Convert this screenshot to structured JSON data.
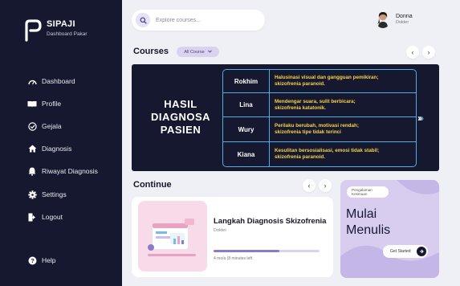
{
  "app": {
    "name": "SIPAJI",
    "subtitle": "Dashboard Pakar"
  },
  "sidebar": {
    "items": [
      {
        "label": "Dashboard",
        "icon": "gauge-icon"
      },
      {
        "label": "Profile",
        "icon": "book-open-icon"
      },
      {
        "label": "Gejala",
        "icon": "check-circle-icon"
      },
      {
        "label": "Diagnosis",
        "icon": "home-icon"
      },
      {
        "label": "Riwayat Diagnosis",
        "icon": "bell-icon"
      },
      {
        "label": "Settings",
        "icon": "gear-icon"
      },
      {
        "label": "Logout",
        "icon": "logout-icon"
      }
    ],
    "help_label": "Help"
  },
  "search": {
    "placeholder": "Explore courses..."
  },
  "user": {
    "name": "Donna",
    "role": "Dokter"
  },
  "courses": {
    "title": "Courses",
    "filter_label": "All Course",
    "prev": "‹",
    "next": "›"
  },
  "banner": {
    "title_line1": "HASIL",
    "title_line2": "DIAGNOSA",
    "title_line3": "PASIEN",
    "rows": [
      {
        "name": "Rokhim",
        "desc_line1": "Halusinasi visual dan gangguan pemikiran;",
        "desc_line2": "skizofrenia paranoid."
      },
      {
        "name": "Lina",
        "desc_line1": "Mendengar suara, sulit berbicara;",
        "desc_line2": "skizofrenia katatonik."
      },
      {
        "name": "Wury",
        "desc_line1": "Perilaku berubah, motivasi rendah;",
        "desc_line2": "skizofrenia tipe tidak terinci"
      },
      {
        "name": "Kiana",
        "desc_line1": "Kesulitan bersosialisasi, emosi tidak stabil;",
        "desc_line2": "skizofrenia paranoid."
      }
    ]
  },
  "continue": {
    "title": "Continue",
    "prev": "‹",
    "next": "›",
    "course_title": "Langkah Diagnosis Skizofrenia",
    "course_author": "Dokter",
    "progress_text": "4 mo/a (8 minutes left",
    "progress": 0.62
  },
  "writing": {
    "badge_line1": "Pengalaman",
    "badge_line2": "Kesmuan",
    "title_line1": "Mulai",
    "title_line2": "Menulis",
    "button_label": "Get Started"
  },
  "colors": {
    "sidebar_bg": "#15182e",
    "accent_purple": "#d8cdef",
    "table_border": "#4fb0e0",
    "table_text": "#f6d24a"
  }
}
